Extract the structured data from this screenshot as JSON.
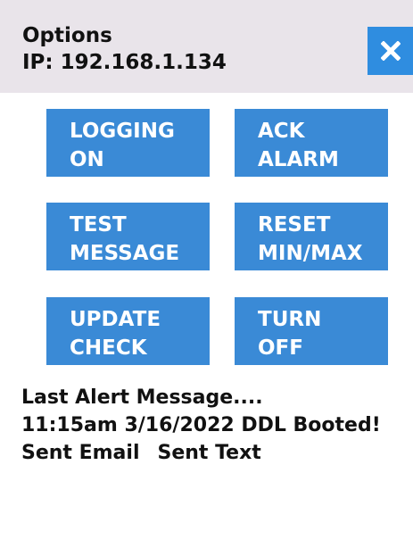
{
  "header": {
    "title": "Options",
    "ip": "IP: 192.168.1.134",
    "close_icon": "close-icon"
  },
  "buttons": {
    "logging": {
      "line1": "LOGGING",
      "line2": "ON"
    },
    "ack_alarm": {
      "line1": "ACK",
      "line2": "ALARM"
    },
    "test_message": {
      "line1": "TEST",
      "line2": "MESSAGE"
    },
    "reset_minmax": {
      "line1": "RESET",
      "line2": "MIN/MAX"
    },
    "update_check": {
      "line1": "UPDATE",
      "line2": "CHECK"
    },
    "turn_off": {
      "line1": "TURN",
      "line2": "OFF"
    }
  },
  "alert": {
    "heading": "Last Alert Message....",
    "detail": "11:15am 3/16/2022 DDL Booted!",
    "sent_email": "Sent Email",
    "sent_text": "Sent Text"
  },
  "colors": {
    "header_bg": "#e9e4ea",
    "button_bg": "#3a8ad6",
    "close_bg": "#2f8de0",
    "button_text": "#ffffff"
  }
}
